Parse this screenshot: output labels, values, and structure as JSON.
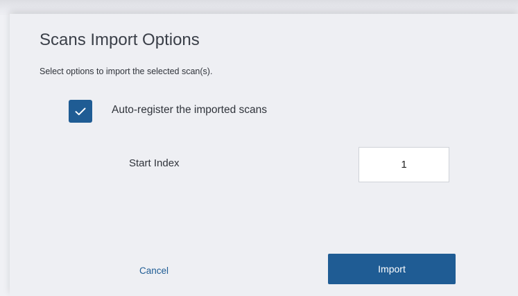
{
  "dialog": {
    "title": "Scans Import Options",
    "subtitle": "Select options to import the selected scan(s)."
  },
  "auto_register": {
    "checked": true,
    "label": "Auto-register the imported scans",
    "icon": "checkmark-icon"
  },
  "start_index": {
    "label": "Start Index",
    "value": "1"
  },
  "actions": {
    "cancel_label": "Cancel",
    "import_label": "Import"
  },
  "colors": {
    "accent": "#1f5c94",
    "background": "#eeeff3",
    "text": "#2f333a"
  }
}
